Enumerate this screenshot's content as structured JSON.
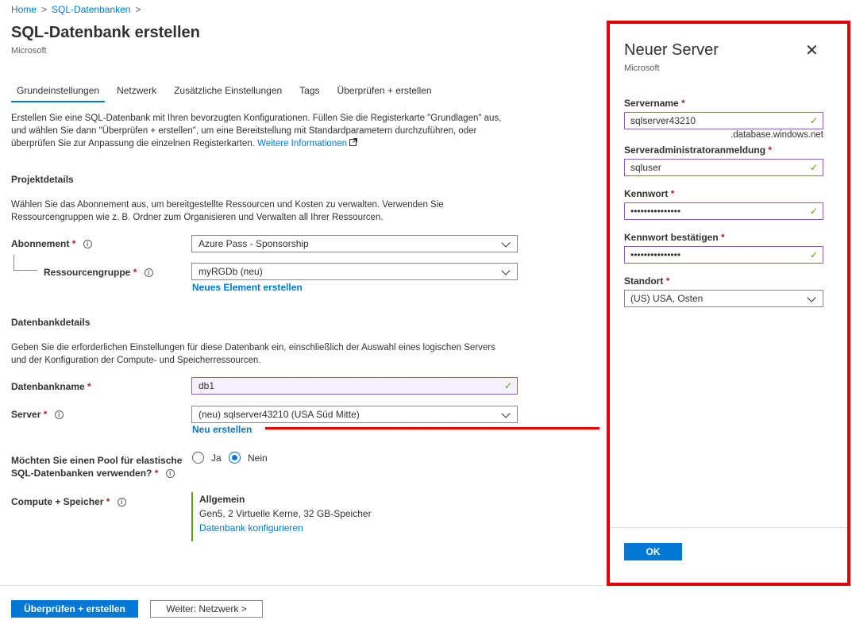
{
  "breadcrumb": {
    "home": "Home",
    "sep": ">",
    "current": "SQL-Datenbanken",
    "sep2": ">"
  },
  "page": {
    "title": "SQL-Datenbank erstellen",
    "subtitle": "Microsoft"
  },
  "tabs": [
    "Grundeinstellungen",
    "Netzwerk",
    "Zusätzliche Einstellungen",
    "Tags",
    "Überprüfen + erstellen"
  ],
  "intro": {
    "text": "Erstellen Sie eine SQL-Datenbank mit Ihren bevorzugten Konfigurationen. Füllen Sie die Registerkarte \"Grundlagen\" aus, und wählen Sie dann \"Überprüfen + erstellen\", um eine Bereitstellung mit Standardparametern durchzuführen, oder überprüfen Sie zur Anpassung die einzelnen Registerkarten.",
    "link": "Weitere Informationen"
  },
  "project": {
    "heading": "Projektdetails",
    "description": "Wählen Sie das Abonnement aus, um bereitgestellte Ressourcen und Kosten zu verwalten. Verwenden Sie Ressourcengruppen wie z. B. Ordner zum Organisieren und Verwalten all Ihrer Ressourcen.",
    "subscription_label": "Abonnement",
    "subscription_value": "Azure Pass - Sponsorship",
    "rg_label": "Ressourcengruppe",
    "rg_value": "myRGDb (neu)",
    "rg_new_link": "Neues Element erstellen"
  },
  "database": {
    "heading": "Datenbankdetails",
    "description": "Geben Sie die erforderlichen Einstellungen für diese Datenbank ein, einschließlich der Auswahl eines logischen Servers und der Konfiguration der Compute- und Speicherressourcen.",
    "name_label": "Datenbankname",
    "name_value": "db1",
    "server_label": "Server",
    "server_value": "(neu) sqlserver43210 (USA Süd Mitte)",
    "server_new_link": "Neu erstellen",
    "pool_label_1": "Möchten Sie einen Pool für elastische",
    "pool_label_2": "SQL-Datenbanken verwenden?",
    "pool_yes": "Ja",
    "pool_no": "Nein",
    "pool_selected": "Nein",
    "compute_label": "Compute + Speicher",
    "compute_tier": "Allgemein",
    "compute_detail": "Gen5, 2 Virtuelle Kerne, 32 GB-Speicher",
    "compute_link": "Datenbank konfigurieren"
  },
  "required_mark": "*",
  "info_icon": "i",
  "check_mark": "✓",
  "footer": {
    "review_button": "Überprüfen + erstellen",
    "next_button": "Weiter: Netzwerk >"
  },
  "panel": {
    "title": "Neuer Server",
    "subtitle": "Microsoft",
    "close": "✕",
    "servername_label": "Servername",
    "servername_value": "sqlserver43210",
    "domain_suffix": ".database.windows.net",
    "admin_label": "Serveradministratoranmeldung",
    "admin_value": "sqluser",
    "password_label": "Kennwort",
    "password_value": "•••••••••••••••",
    "confirm_label": "Kennwort bestätigen",
    "confirm_value": "•••••••••••••••",
    "location_label": "Standort",
    "location_value": "(US) USA, Osten",
    "ok_button": "OK"
  },
  "colors": {
    "accent": "#0078d4",
    "highlight": "#e60000",
    "valid": "#57a300"
  }
}
